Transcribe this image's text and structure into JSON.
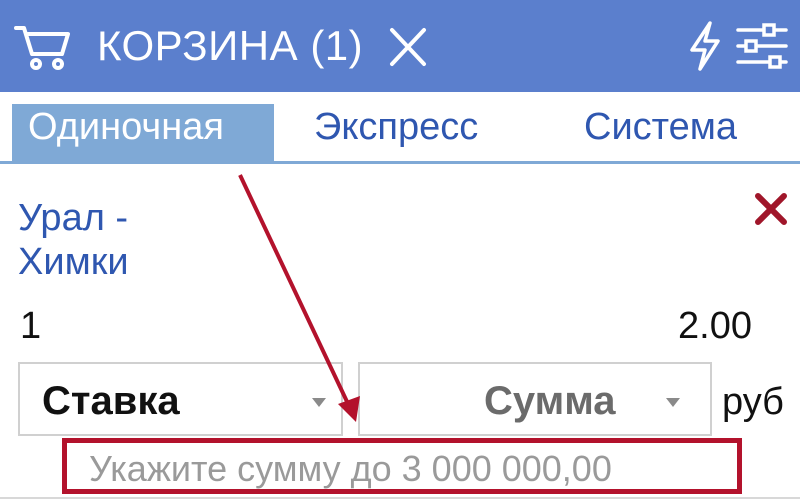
{
  "header": {
    "title": "КОРЗИНА (1)",
    "icons": [
      "cart-icon",
      "close-icon",
      "bolt-icon",
      "filters-icon"
    ],
    "background": "#5b7fcd"
  },
  "tabs": [
    {
      "label": "Одиночная",
      "active": true
    },
    {
      "label": "Экспресс",
      "active": false
    },
    {
      "label": "Система",
      "active": false
    }
  ],
  "bet": {
    "match": "Урал - Химки",
    "outcome": "1",
    "odds": "2.00"
  },
  "inputs": {
    "stake_label": "Ставка",
    "amount_label": "Сумма",
    "currency": "руб",
    "hint": "Укажите сумму до 3 000 000,00"
  },
  "colors": {
    "accent": "#2f57b0",
    "tab_active": "#7fa9d6",
    "annotation": "#b3122c",
    "remove": "#a0162a"
  }
}
